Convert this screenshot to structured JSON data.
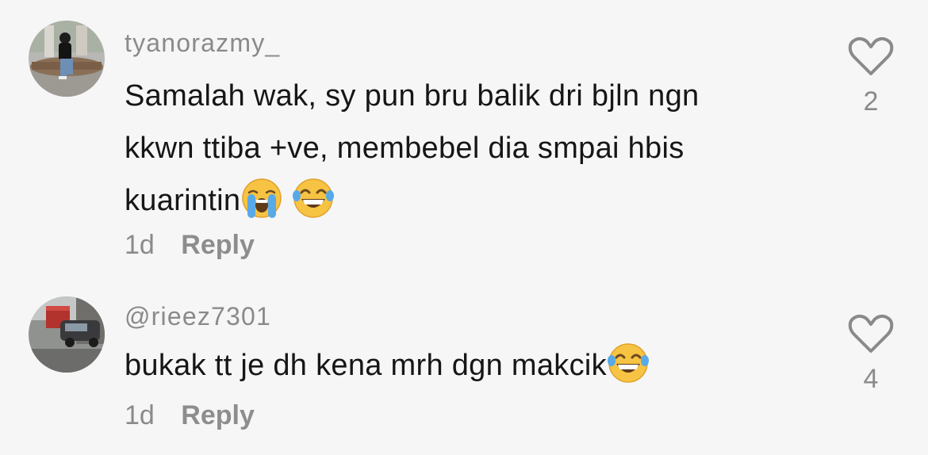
{
  "comments": [
    {
      "username": "tyanorazmy_",
      "text_lines": [
        "Samalah wak, sy pun bru balik dri bjln ngn",
        "kkwn ttiba +ve, membebel dia smpai hbis",
        "kuarintin"
      ],
      "emojis": [
        "loudly-crying-face-icon",
        "face-with-tears-of-joy-icon"
      ],
      "time": "1d",
      "reply_label": "Reply",
      "like_count": "2"
    },
    {
      "username": "@rieez7301",
      "text_lines": [
        "bukak tt je dh kena mrh dgn makcik"
      ],
      "emojis": [
        "face-with-tears-of-joy-icon"
      ],
      "time": "1d",
      "reply_label": "Reply",
      "like_count": "4"
    }
  ],
  "colors": {
    "background": "#f6f6f6",
    "text": "#161616",
    "muted": "#8a8a8a"
  }
}
